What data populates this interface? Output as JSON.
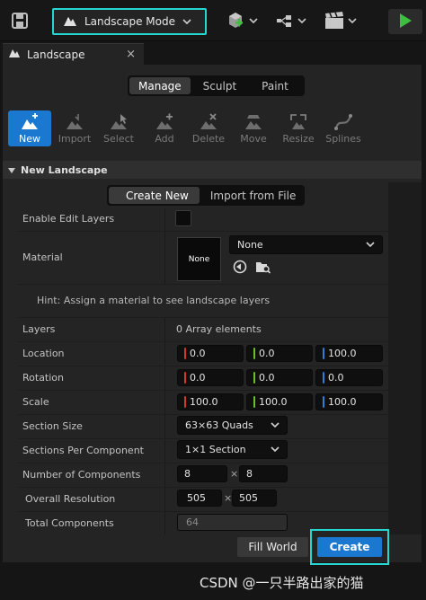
{
  "toolbar": {
    "mode_label": "Landscape Mode",
    "icons": [
      "save-icon",
      "landscape-mode-icon",
      "add-actor-icon",
      "blueprint-icon",
      "cinematics-icon",
      "play-icon"
    ]
  },
  "tab": {
    "title": "Landscape",
    "close_glyph": "×"
  },
  "modes": [
    "Manage",
    "Sculpt",
    "Paint"
  ],
  "tools": [
    {
      "label": "New",
      "icon": "new-icon"
    },
    {
      "label": "Import",
      "icon": "import-icon"
    },
    {
      "label": "Select",
      "icon": "select-icon"
    },
    {
      "label": "Add",
      "icon": "add-icon"
    },
    {
      "label": "Delete",
      "icon": "delete-icon"
    },
    {
      "label": "Move",
      "icon": "move-icon"
    },
    {
      "label": "Resize",
      "icon": "resize-icon"
    },
    {
      "label": "Splines",
      "icon": "splines-icon"
    }
  ],
  "section": {
    "title": "New Landscape"
  },
  "subtabs": [
    "Create New",
    "Import from File"
  ],
  "properties": {
    "enable_edit_layers": "Enable Edit Layers",
    "material": "Material",
    "material_thumb": "None",
    "material_value": "None",
    "hint": "Hint: Assign a material to see landscape layers",
    "layers": "Layers",
    "layers_value": "0 Array elements",
    "location": "Location",
    "location_values": [
      "0.0",
      "0.0",
      "100.0"
    ],
    "rotation": "Rotation",
    "rotation_values": [
      "0.0",
      "0.0",
      "0.0"
    ],
    "scale": "Scale",
    "scale_values": [
      "100.0",
      "100.0",
      "100.0"
    ],
    "section_size": "Section Size",
    "section_size_value": "63×63 Quads",
    "sections_per_component": "Sections Per Component",
    "sections_per_component_value": "1×1 Section",
    "number_of_components": "Number of Components",
    "number_of_components_values": [
      "8",
      "8"
    ],
    "overall_resolution": "Overall Resolution",
    "overall_resolution_values": [
      "505",
      "505"
    ],
    "total_components": "Total Components",
    "total_components_value": "64",
    "times_glyph": "×"
  },
  "buttons": {
    "fill_world": "Fill World",
    "create": "Create"
  },
  "watermark": "CSDN @一只半路出家的猫",
  "colors": {
    "accent_blue": "#1b78d0",
    "highlight_cyan": "#25d7d0",
    "x_axis": "#d13b2f",
    "y_axis": "#6cbf2a",
    "z_axis": "#2f7fd6",
    "play_green": "#3fbf3f"
  }
}
